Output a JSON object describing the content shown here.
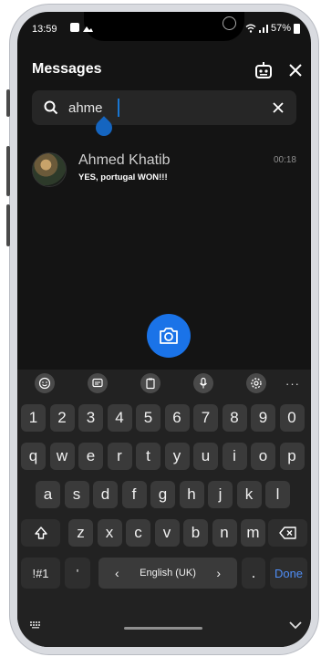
{
  "status": {
    "time": "13:59",
    "battery": "57%"
  },
  "header": {
    "title": "Messages"
  },
  "search": {
    "query": "ahme"
  },
  "chats": [
    {
      "name": "Ahmed Khatib",
      "preview": "YES, portugal WON!!!",
      "time": "00:18"
    }
  ],
  "keyboard": {
    "toolbar_more": "···",
    "number_row": [
      "1",
      "2",
      "3",
      "4",
      "5",
      "6",
      "7",
      "8",
      "9",
      "0"
    ],
    "row1": [
      "q",
      "w",
      "e",
      "r",
      "t",
      "y",
      "u",
      "i",
      "o",
      "p"
    ],
    "row2": [
      "a",
      "s",
      "d",
      "f",
      "g",
      "h",
      "j",
      "k",
      "l"
    ],
    "row3": [
      "z",
      "x",
      "c",
      "v",
      "b",
      "n",
      "m"
    ],
    "symbols_key": "!#1",
    "comma_key": "'",
    "lang_left": "‹",
    "language": "English (UK)",
    "lang_right": "›",
    "period_key": ".",
    "done_key": "Done"
  },
  "colors": {
    "accent": "#1a73e8",
    "background": "#141414",
    "keyboard_bg": "#222222"
  }
}
